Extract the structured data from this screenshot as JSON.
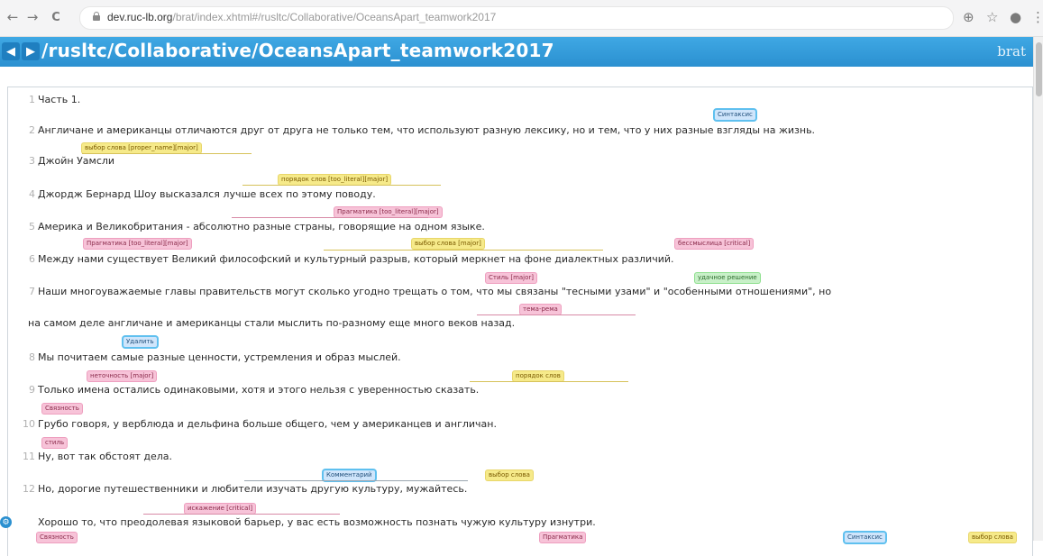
{
  "browser": {
    "back_icon": "←",
    "forward_icon": "→",
    "reload_icon": "C",
    "url_host": "dev.ruc-lb.org",
    "url_path": "/brat/index.xhtml#/rusltc/Collaborative/OceansApart_teamwork2017",
    "zoom_icon": "⊕",
    "star_icon": "☆",
    "account_icon": "●",
    "menu_icon": "⋮"
  },
  "header": {
    "back_label": "◀",
    "forward_label": "▶",
    "path": "/rusltc/Collaborative/OceansApart_teamwork2017",
    "brand": "brat"
  },
  "lines": [
    {
      "num": "1",
      "text": "Часть 1."
    },
    {
      "num": "2",
      "text": "Англичане и американцы отличаются друг от друга не только тем, что используют разную лексику, но и тем, что у них разные взгляды на жизнь."
    },
    {
      "num": "3",
      "text": "Джойн          Уамсли"
    },
    {
      "num": "4",
      "text": "Джордж Бернард Шоу высказался лучше всех по этому поводу."
    },
    {
      "num": "5",
      "text": "Америка и Великобритания - абсолютно разные страны, говорящие на одном языке."
    },
    {
      "num": "6",
      "text": "Между                нами                существует Великий философский и культурный разрыв, который         меркнет          на фоне диалектных различий."
    },
    {
      "num": "7",
      "text": "Наши многоуважаемые главы правительств могут сколько угодно   трещать    о том, что мы связаны \"тесными узами\" и \"особенными отношениями\", но"
    },
    {
      "num": "",
      "text": "на самом деле англичане и американцы стали мыслить по-разному еще много веков назад."
    },
    {
      "num": "8",
      "text": "Мы почитаем самые разные ценности, устремления и образ мыслей."
    },
    {
      "num": "9",
      "text": "Только        имена         остались одинаковыми, хотя и этого нельзя с уверенностью сказать."
    },
    {
      "num": "10",
      "text": "Грубо говоря, у верблюда и дельфина больше общего, чем у американцев и англичан."
    },
    {
      "num": "11",
      "text": "Ну, вот так обстоят дела."
    },
    {
      "num": "12",
      "text": "Но, дорогие путешественники и любители изучать другую культуру, мужайтесь."
    },
    {
      "num": "",
      "text": "Хорошо то, что преодолевая языковой барьер, у вас есть возможность познать чужую культуру изнутри."
    }
  ],
  "annotations": [
    {
      "label": "Синтаксис",
      "color": "blue"
    },
    {
      "label": "выбор слова [proper_name][major]",
      "color": "yellow"
    },
    {
      "label": "порядок слов [too_literal][major]",
      "color": "yellow"
    },
    {
      "label": "Прагматика [too_literal][major]",
      "color": "pink"
    },
    {
      "label": "Прагматика [too_literal][major]",
      "color": "pink"
    },
    {
      "label": "выбор слова [major]",
      "color": "yellow"
    },
    {
      "label": "бессмыслица [critical]",
      "color": "pink"
    },
    {
      "label": "Стиль [major]",
      "color": "pink"
    },
    {
      "label": "удачное решение",
      "color": "green"
    },
    {
      "label": "тема-рема",
      "color": "pink"
    },
    {
      "label": "Удалить",
      "color": "blue"
    },
    {
      "label": "неточность [major]",
      "color": "pink"
    },
    {
      "label": "порядок слов",
      "color": "yellow"
    },
    {
      "label": "Связность",
      "color": "pink"
    },
    {
      "label": "стиль",
      "color": "pink"
    },
    {
      "label": "Комментарий",
      "color": "blue"
    },
    {
      "label": "выбор слова",
      "color": "yellow"
    },
    {
      "label": "искажение [critical]",
      "color": "pink"
    },
    {
      "label": "Связность",
      "color": "pink"
    },
    {
      "label": "Прагматика",
      "color": "pink"
    },
    {
      "label": "Синтаксис",
      "color": "blue"
    },
    {
      "label": "выбор слова",
      "color": "yellow"
    }
  ],
  "colors": {
    "header": "#2b90d0",
    "ann_yellow": "#f6ea8a",
    "ann_pink": "#f7c3d8",
    "ann_green": "#c8f0c8",
    "ann_blue_border": "#5fc0ef"
  },
  "gear_icon": "⚙"
}
